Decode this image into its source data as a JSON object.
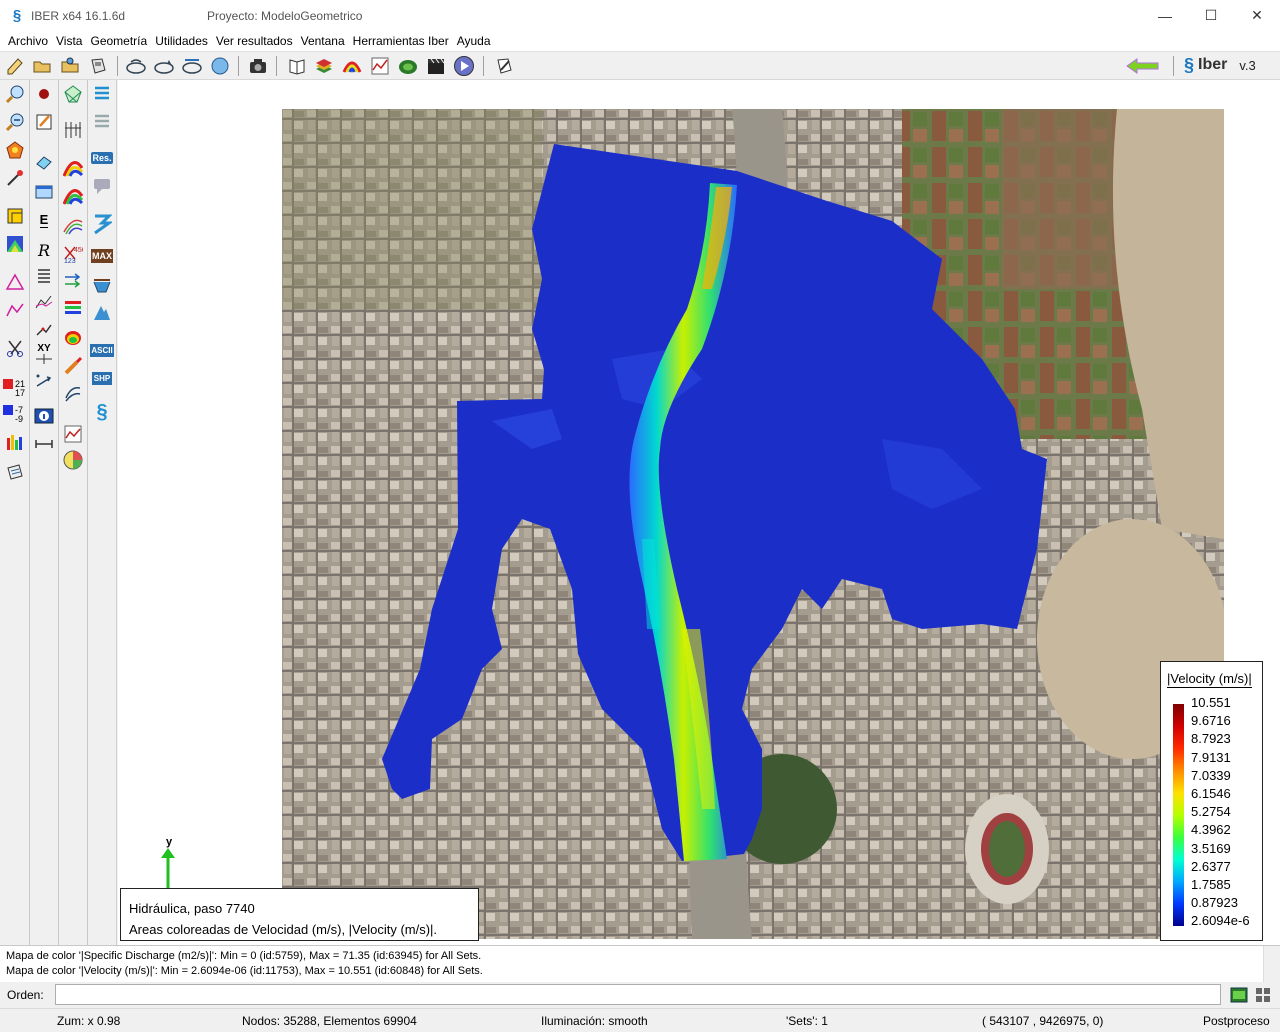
{
  "window": {
    "app_name": "IBER x64 16.1.6d",
    "project": "Proyecto: ModeloGeometrico",
    "minimize": "—",
    "maximize": "☐",
    "close": "✕"
  },
  "menu": [
    {
      "label": "Archivo"
    },
    {
      "label": "Vista"
    },
    {
      "label": "Geometría"
    },
    {
      "label": "Utilidades"
    },
    {
      "label": "Ver resultados"
    },
    {
      "label": "Ventana"
    },
    {
      "label": "Herramientas Iber"
    },
    {
      "label": "Ayuda"
    }
  ],
  "brand": {
    "logo": "Iber",
    "version": "v.3"
  },
  "palette_text": {
    "res": "Res.",
    "max": "MAX",
    "ascii": "ASCII",
    "shp": "SHP",
    "xy": "XY",
    "e": "E",
    "r": "R",
    "n21": "21",
    "n17": "17",
    "n7": "-7",
    "n9": "-9",
    "n456": "456",
    "n123": "123"
  },
  "legend": {
    "title": "|Velocity (m/s)|",
    "labels": [
      "10.551",
      "9.6716",
      "8.7923",
      "7.9131",
      "7.0339",
      "6.1546",
      "5.2754",
      "4.3962",
      "3.5169",
      "2.6377",
      "1.7585",
      "0.87923",
      "2.6094e-6"
    ]
  },
  "axis": {
    "label": "y"
  },
  "info": {
    "line1": "Hidráulica, paso 7740",
    "line2": "Areas coloreadas de Velocidad (m/s), |Velocity (m/s)|."
  },
  "messages": [
    "Mapa de color '|Specific Discharge (m2/s)|': Min = 0 (id:5759), Max = 71.35 (id:63945) for All Sets.",
    "Mapa de color '|Velocity (m/s)|': Min = 2.6094e-06 (id:11753), Max = 10.551 (id:60848) for All Sets."
  ],
  "command": {
    "label": "Orden:",
    "value": ""
  },
  "status": {
    "zoom": "Zum: x 0.98",
    "nodes": "Nodos: 35288, Elementos 69904",
    "lighting": "Iluminación: smooth",
    "sets": "'Sets': 1",
    "coords": "( 543107 ,  9426975,  0)",
    "mode": "Postproceso"
  },
  "colors": {
    "accent": "#1a78c2",
    "flood_blue": "#1b2fc8",
    "channel_high": "#ffe000",
    "channel_mid": "#3cff3c"
  }
}
